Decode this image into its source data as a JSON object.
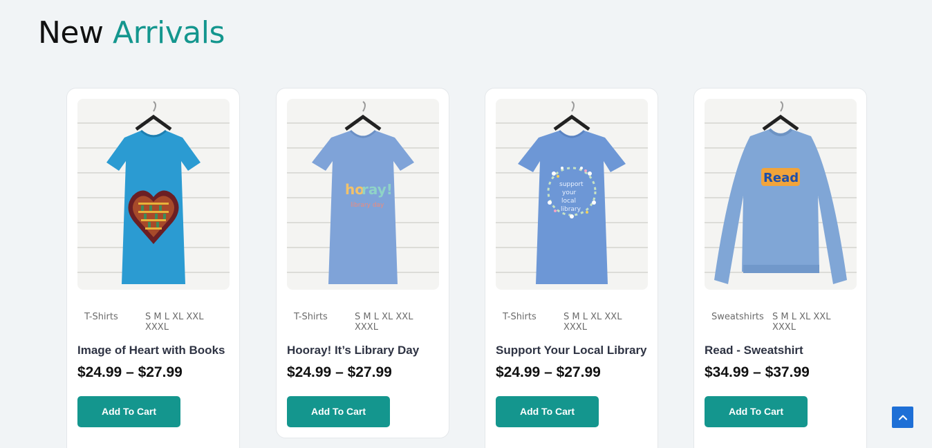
{
  "section": {
    "title_word1": "New",
    "title_word2": "Arrivals"
  },
  "products": [
    {
      "category": "T-Shirts",
      "sizes": "S M L XL XXL XXXL",
      "name": "Image of Heart with Books",
      "price": "$24.99 – $27.99",
      "button": "Add To Cart",
      "shirt_color": "#2b9bd2",
      "graphic": "heart-books"
    },
    {
      "category": "T-Shirts",
      "sizes": "S M L XL XXL XXXL",
      "name": "Hooray! It’s Library Day",
      "price": "$24.99 – $27.99",
      "button": "Add To Cart",
      "shirt_color": "#7fa3d8",
      "graphic": "hooray-text"
    },
    {
      "category": "T-Shirts",
      "sizes": "S M L XL XXL XXXL",
      "name": "Support Your Local Library",
      "price": "$24.99 – $27.99",
      "button": "Add To Cart",
      "shirt_color": "#6d97d6",
      "graphic": "floral-wreath"
    },
    {
      "category": "Sweatshirts",
      "sizes": "S M L XL XXL XXXL",
      "name": "Read - Sweatshirt",
      "price": "$34.99 – $37.99",
      "button": "Add To Cart",
      "shirt_color": "#80a6d6",
      "graphic": "read-text"
    }
  ],
  "scroll_top": {
    "icon": "chevron-up-icon",
    "color": "#1e6fd6"
  },
  "colors": {
    "accent": "#14968e",
    "background": "#f1f4f6"
  }
}
